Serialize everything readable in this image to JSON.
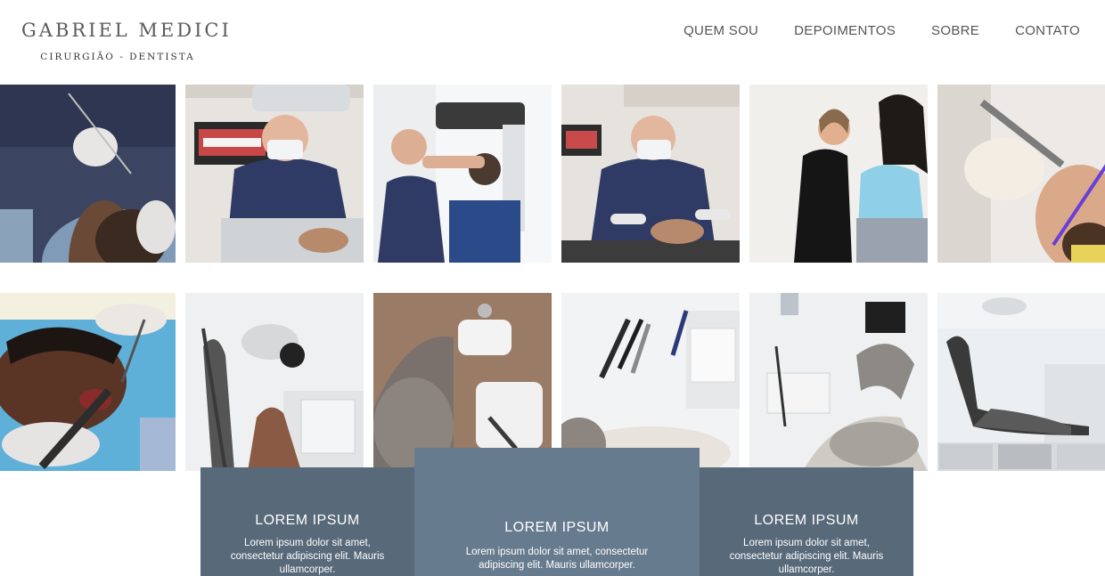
{
  "brand": {
    "name": "GABRIEL MEDICI",
    "subtitle": "CIRURGIÃO - DENTISTA"
  },
  "nav": {
    "items": [
      "QUEM SOU",
      "DEPOIMENTOS",
      "SOBRE",
      "CONTATO"
    ]
  },
  "gallery": {
    "row1": [
      "dentist-treating-patient",
      "dentist-portrait-blue-scrubs",
      "dentist-xray-machine",
      "dentist-with-patient-chair",
      "assistant-with-patient",
      "dental-tool-closeup"
    ],
    "row2": [
      "patient-mouth-exam",
      "dental-chair-lamp",
      "dental-chair-top-view",
      "dental-instruments-tray",
      "dental-clinic-room",
      "dental-clinic-collage"
    ]
  },
  "cards": [
    {
      "title": "LOREM IPSUM",
      "text": "Lorem ipsum dolor sit amet, consectetur adipiscing elit. Mauris ullamcorper."
    },
    {
      "title": "LOREM IPSUM",
      "text": "Lorem ipsum dolor sit amet, consectetur adipiscing elit. Mauris ullamcorper."
    },
    {
      "title": "LOREM IPSUM",
      "text": "Lorem ipsum dolor sit amet, consectetur adipiscing elit. Mauris ullamcorper."
    }
  ],
  "colors": {
    "card_dark": "#58697a",
    "card_mid": "#677b8e",
    "scrubs": "#2e3a63"
  }
}
